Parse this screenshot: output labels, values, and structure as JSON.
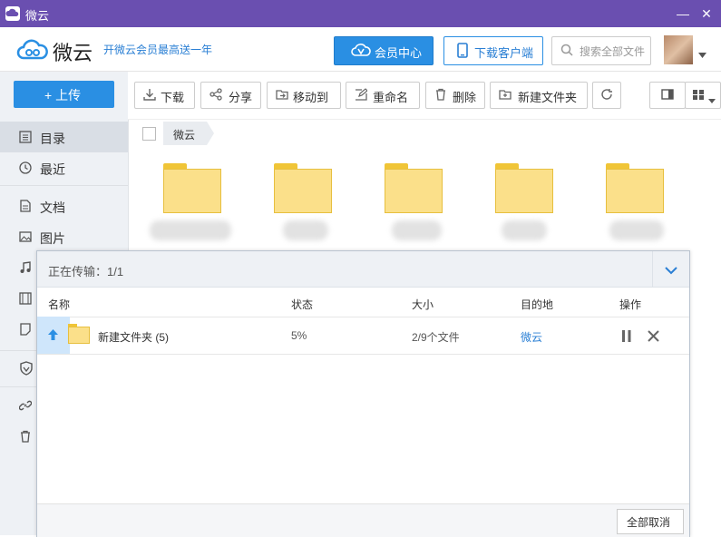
{
  "window": {
    "title": "微云"
  },
  "header": {
    "brand_name": "微云",
    "promo_text": "开微云会员最高送一年",
    "vip_button": "会员中心",
    "client_button": "下载客户端",
    "search_placeholder": "搜索全部文件"
  },
  "sidebar": {
    "upload_button": "+ 上传",
    "items": [
      {
        "label": "目录",
        "icon": "list-icon",
        "active": true
      },
      {
        "label": "最近",
        "icon": "clock-icon"
      },
      {
        "label": "文档",
        "icon": "document-icon"
      },
      {
        "label": "图片",
        "icon": "image-icon"
      },
      {
        "label": "",
        "icon": "music-icon"
      },
      {
        "label": "",
        "icon": "video-icon"
      },
      {
        "label": "",
        "icon": "note-icon"
      },
      {
        "label": "",
        "icon": "shield-icon"
      },
      {
        "label": "",
        "icon": "link-icon"
      },
      {
        "label": "",
        "icon": "trash-icon"
      }
    ]
  },
  "toolbar": {
    "download": "下载",
    "share": "分享",
    "move_to": "移动到",
    "rename": "重命名",
    "delete": "删除",
    "new_folder": "新建文件夹"
  },
  "breadcrumb": {
    "root": "微云"
  },
  "transfer": {
    "status_title": "正在传输：1/1",
    "columns": {
      "name": "名称",
      "status": "状态",
      "size": "大小",
      "destination": "目的地",
      "actions": "操作"
    },
    "rows": [
      {
        "name": "新建文件夹 (5)",
        "status": "5%",
        "size": "2/9个文件",
        "destination": "微云",
        "progress": 0.05
      }
    ],
    "cancel_all": "全部取消"
  },
  "colors": {
    "accent": "#2a8fe3",
    "titlebar": "#6a4fb0",
    "folder": "#fbe08a"
  }
}
